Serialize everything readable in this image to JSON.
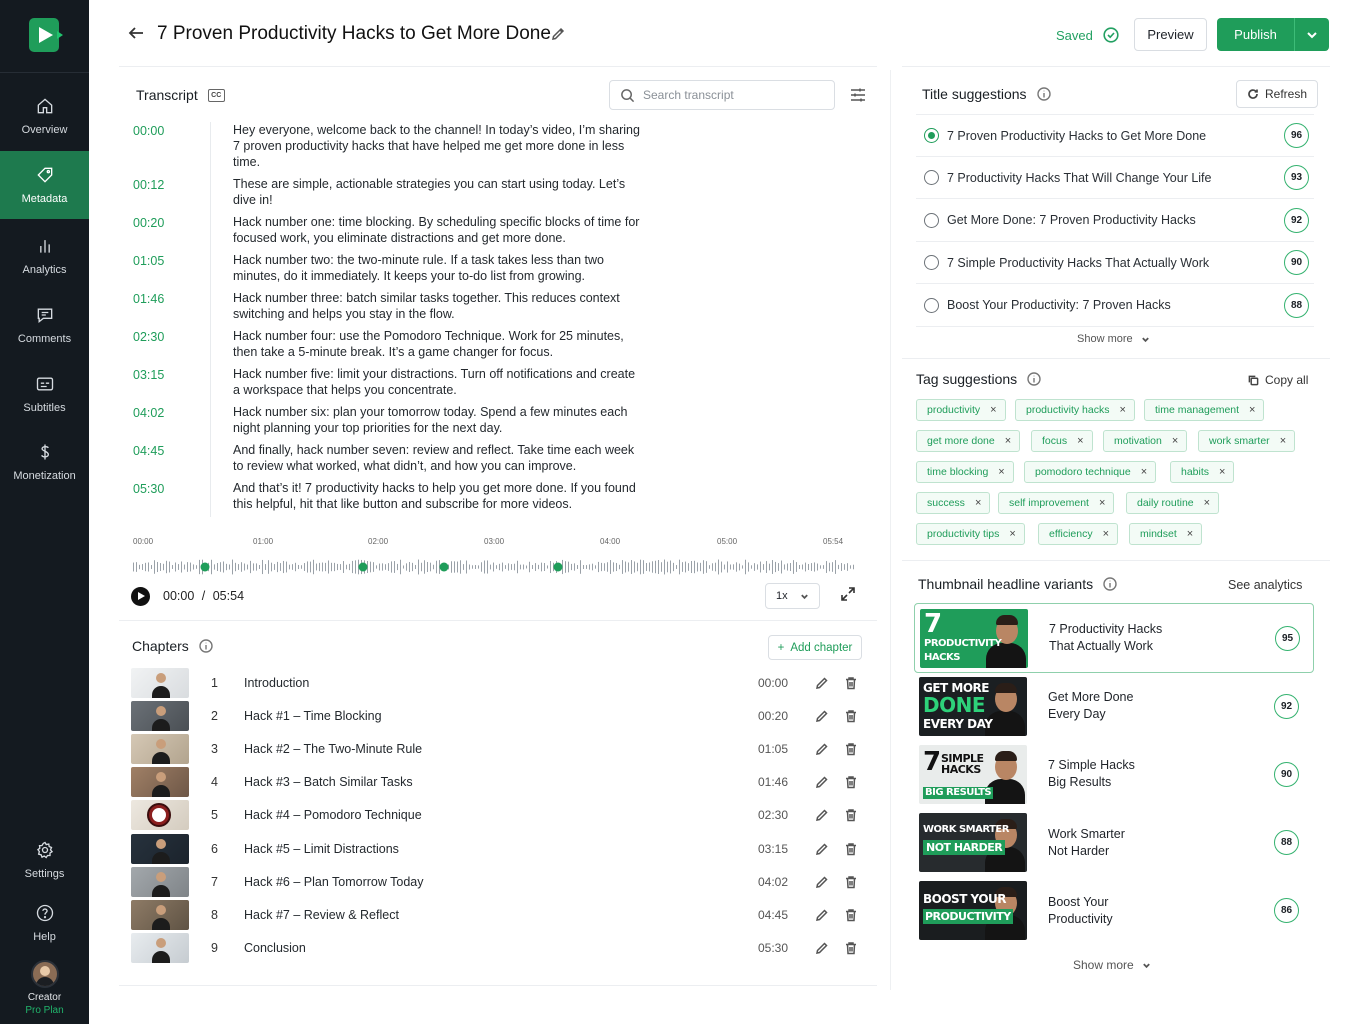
{
  "sidebar": {
    "items": [
      {
        "label": "Overview",
        "icon": "home-icon",
        "active": false
      },
      {
        "label": "Metadata",
        "icon": "tag-icon",
        "active": true
      },
      {
        "label": "Analytics",
        "icon": "bar-chart-icon",
        "active": false
      },
      {
        "label": "Comments",
        "icon": "comment-icon",
        "active": false
      },
      {
        "label": "Subtitles",
        "icon": "subtitles-icon",
        "active": false
      },
      {
        "label": "Monetization",
        "icon": "dollar-icon",
        "active": false
      }
    ],
    "bottom": [
      {
        "label": "Settings",
        "icon": "gear-icon"
      },
      {
        "label": "Help",
        "icon": "help-icon"
      }
    ],
    "creator": {
      "name": "Creator",
      "plan": "Pro Plan"
    }
  },
  "header": {
    "title": "7 Proven Productivity Hacks to Get More Done",
    "saved": "Saved",
    "preview": "Preview",
    "publish": "Publish"
  },
  "transcript": {
    "title": "Transcript",
    "cc": "CC",
    "search_placeholder": "Search transcript",
    "lines": [
      {
        "time": "00:00",
        "text": "Hey everyone, welcome back to the channel! In today’s video, I’m sharing 7 proven productivity hacks that have helped me get more done in less time."
      },
      {
        "time": "00:12",
        "text": "These are simple, actionable strategies you can start using today. Let’s dive in!"
      },
      {
        "time": "00:20",
        "text": "Hack number one: time blocking. By scheduling specific blocks of time for focused work, you eliminate distractions and get more done."
      },
      {
        "time": "01:05",
        "text": "Hack number two: the two-minute rule. If a task takes less than two minutes, do it immediately. It keeps your to-do list from growing."
      },
      {
        "time": "01:46",
        "text": "Hack number three: batch similar tasks together. This reduces context switching and helps you stay in the flow."
      },
      {
        "time": "02:30",
        "text": "Hack number four: use the Pomodoro Technique. Work for 25 minutes, then take a 5-minute break. It’s a game changer for focus."
      },
      {
        "time": "03:15",
        "text": "Hack number five: limit your distractions. Turn off notifications and create a workspace that helps you concentrate."
      },
      {
        "time": "04:02",
        "text": "Hack number six: plan your tomorrow today. Spend a few minutes each night planning your top priorities for the next day."
      },
      {
        "time": "04:45",
        "text": "And finally, hack number seven: review and reflect. Take time each week to review what worked, what didn’t, and how you can improve."
      },
      {
        "time": "05:30",
        "text": "And that’s it! 7 productivity hacks to help you get more done. If you found this helpful, hit that like button and subscribe for more videos."
      }
    ],
    "timeline_ticks": [
      "00:00",
      "01:00",
      "02:00",
      "03:00",
      "04:00",
      "05:00",
      "05:54"
    ],
    "player": {
      "current": "00:00",
      "separator": "/",
      "duration": "05:54",
      "speed": "1x"
    }
  },
  "chapters": {
    "title": "Chapters",
    "add_label": "Add chapter",
    "items": [
      {
        "num": "1",
        "title": "Introduction",
        "time": "00:00"
      },
      {
        "num": "2",
        "title": "Hack #1 – Time Blocking",
        "time": "00:20"
      },
      {
        "num": "3",
        "title": "Hack #2 – The Two-Minute Rule",
        "time": "01:05"
      },
      {
        "num": "4",
        "title": "Hack #3 – Batch Similar Tasks",
        "time": "01:46"
      },
      {
        "num": "5",
        "title": "Hack #4 – Pomodoro Technique",
        "time": "02:30"
      },
      {
        "num": "6",
        "title": "Hack #5 – Limit Distractions",
        "time": "03:15"
      },
      {
        "num": "7",
        "title": "Hack #6 – Plan Tomorrow Today",
        "time": "04:02"
      },
      {
        "num": "8",
        "title": "Hack #7 – Review & Reflect",
        "time": "04:45"
      },
      {
        "num": "9",
        "title": "Conclusion",
        "time": "05:30"
      }
    ]
  },
  "title_suggestions": {
    "title": "Title suggestions",
    "refresh": "Refresh",
    "show_more": "Show more",
    "items": [
      {
        "text": "7 Proven Productivity Hacks to Get More Done",
        "score": "96",
        "selected": true
      },
      {
        "text": "7 Productivity Hacks That Will Change Your Life",
        "score": "93",
        "selected": false
      },
      {
        "text": "Get More Done: 7 Proven Productivity Hacks",
        "score": "92",
        "selected": false
      },
      {
        "text": "7 Simple Productivity Hacks That Actually Work",
        "score": "90",
        "selected": false
      },
      {
        "text": "Boost Your Productivity: 7 Proven Hacks",
        "score": "88",
        "selected": false
      }
    ]
  },
  "tag_suggestions": {
    "title": "Tag suggestions",
    "copy_all": "Copy all",
    "tags": [
      "productivity",
      "productivity hacks",
      "time management",
      "get more done",
      "focus",
      "motivation",
      "work smarter",
      "time blocking",
      "pomodoro technique",
      "habits",
      "success",
      "self improvement",
      "daily routine",
      "productivity tips",
      "efficiency",
      "mindset"
    ]
  },
  "thumbnail_variants": {
    "title": "Thumbnail headline variants",
    "see_analytics": "See analytics",
    "show_more": "Show more",
    "items": [
      {
        "line1": "7 Productivity Hacks",
        "line2": "That Actually Work",
        "score": "95",
        "thumb": [
          "7",
          "PRODUCTIVITY",
          "HACKS"
        ]
      },
      {
        "line1": "Get More Done",
        "line2": "Every Day",
        "score": "92",
        "thumb": [
          "GET MORE",
          "DONE",
          "EVERY DAY"
        ]
      },
      {
        "line1": "7 Simple Hacks",
        "line2": "Big Results",
        "score": "90",
        "thumb": [
          "7",
          "SIMPLE HACKS",
          "BIG RESULTS"
        ]
      },
      {
        "line1": "Work Smarter",
        "line2": "Not Harder",
        "score": "88",
        "thumb": [
          "WORK SMARTER",
          "NOT HARDER"
        ]
      },
      {
        "line1": "Boost Your",
        "line2": "Productivity",
        "score": "86",
        "thumb": [
          "BOOST YOUR",
          "PRODUCTIVITY"
        ]
      }
    ]
  },
  "colors": {
    "accent": "#1f9d5a",
    "sidebar": "#141a20"
  }
}
